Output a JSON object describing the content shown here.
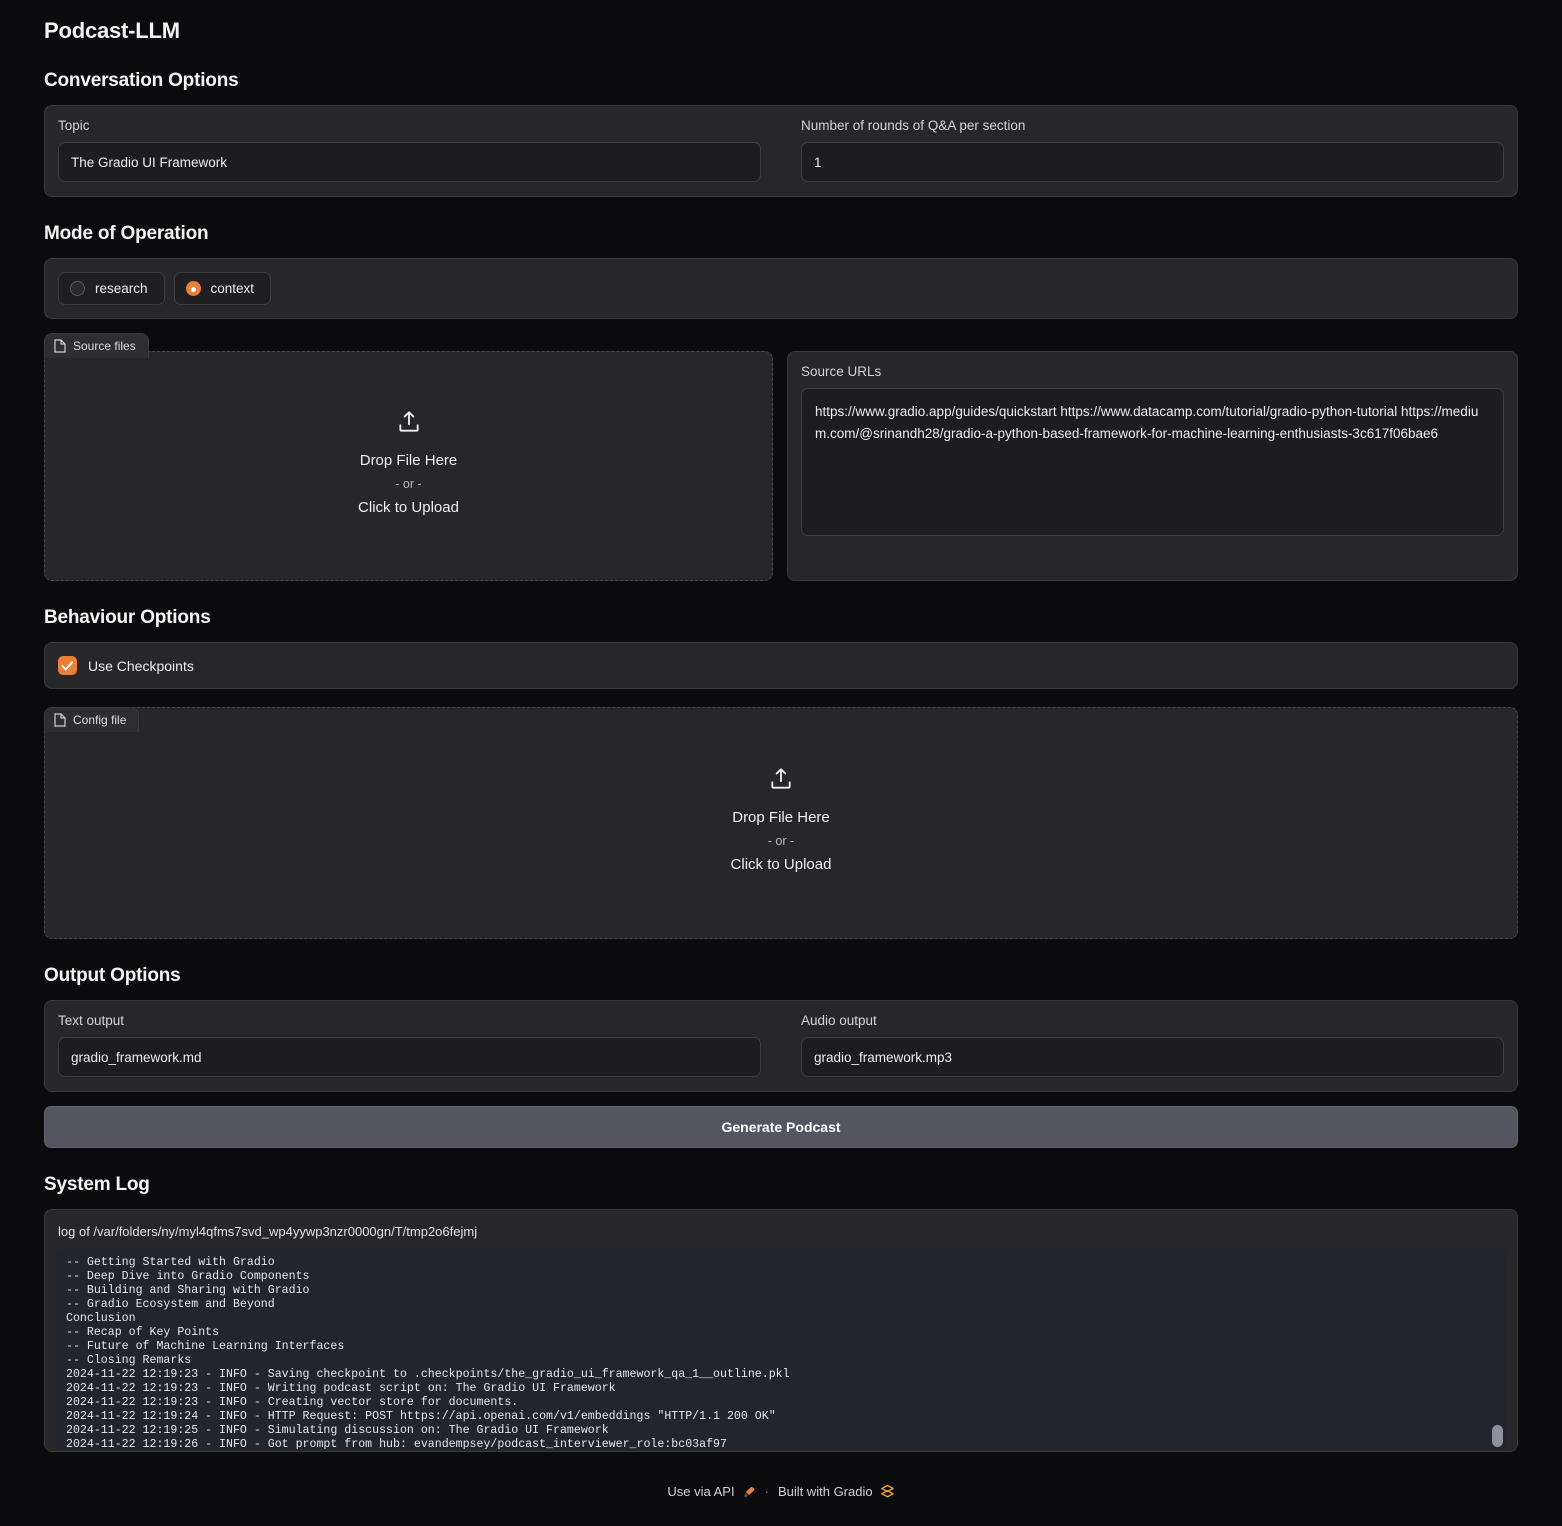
{
  "app": {
    "title": "Podcast-LLM"
  },
  "conversation": {
    "heading": "Conversation Options",
    "topic": {
      "label": "Topic",
      "value": "The Gradio UI Framework"
    },
    "rounds": {
      "label": "Number of rounds of Q&A per section",
      "value": "1"
    }
  },
  "mode": {
    "heading": "Mode of Operation",
    "options": [
      {
        "label": "research",
        "selected": false
      },
      {
        "label": "context",
        "selected": true
      }
    ]
  },
  "source_files": {
    "tab_label": "Source files",
    "tab_icon": "file-icon",
    "upload_icon": "upload-icon",
    "drop_text": "Drop File Here",
    "or_text": "- or -",
    "click_text": "Click to Upload"
  },
  "source_urls": {
    "label": "Source URLs",
    "value": "https://www.gradio.app/guides/quickstart\nhttps://www.datacamp.com/tutorial/gradio-python-tutorial\nhttps://medium.com/@srinandh28/gradio-a-python-based-framework-for-machine-learning-enthusiasts-3c617f06bae6"
  },
  "behaviour": {
    "heading": "Behaviour Options",
    "checkbox": {
      "label": "Use Checkpoints",
      "checked": true
    }
  },
  "config_file": {
    "tab_label": "Config file",
    "tab_icon": "file-icon",
    "upload_icon": "upload-icon",
    "drop_text": "Drop File Here",
    "or_text": "- or -",
    "click_text": "Click to Upload"
  },
  "output": {
    "heading": "Output Options",
    "text_output": {
      "label": "Text output",
      "value": "gradio_framework.md"
    },
    "audio_output": {
      "label": "Audio output",
      "value": "gradio_framework.mp3"
    }
  },
  "generate_button": {
    "label": "Generate Podcast"
  },
  "system_log": {
    "heading": "System Log",
    "path": "log of /var/folders/ny/myl4qfms7svd_wp4yywp3nzr0000gn/T/tmp2o6fejmj",
    "content": "-- Getting Started with Gradio\n-- Deep Dive into Gradio Components\n-- Building and Sharing with Gradio\n-- Gradio Ecosystem and Beyond\nConclusion\n-- Recap of Key Points\n-- Future of Machine Learning Interfaces\n-- Closing Remarks\n2024-11-22 12:19:23 - INFO - Saving checkpoint to .checkpoints/the_gradio_ui_framework_qa_1__outline.pkl\n2024-11-22 12:19:23 - INFO - Writing podcast script on: The Gradio UI Framework\n2024-11-22 12:19:23 - INFO - Creating vector store for documents.\n2024-11-22 12:19:24 - INFO - HTTP Request: POST https://api.openai.com/v1/embeddings \"HTTP/1.1 200 OK\"\n2024-11-22 12:19:25 - INFO - Simulating discussion on: The Gradio UI Framework\n2024-11-22 12:19:26 - INFO - Got prompt from hub: evandempsey/podcast_interviewer_role:bc03af97"
  },
  "footer": {
    "api_label": "Use via API",
    "api_icon": "rocket-icon",
    "separator": "·",
    "gradio_label": "Built with Gradio",
    "gradio_icon": "gradio-logo-icon"
  },
  "colors": {
    "accent": "#e8803a",
    "page_bg": "#0b0b0d",
    "panel_bg": "#27272a",
    "input_bg": "#1d1d20",
    "button_bg": "#55555f",
    "log_bg": "#21252e"
  }
}
